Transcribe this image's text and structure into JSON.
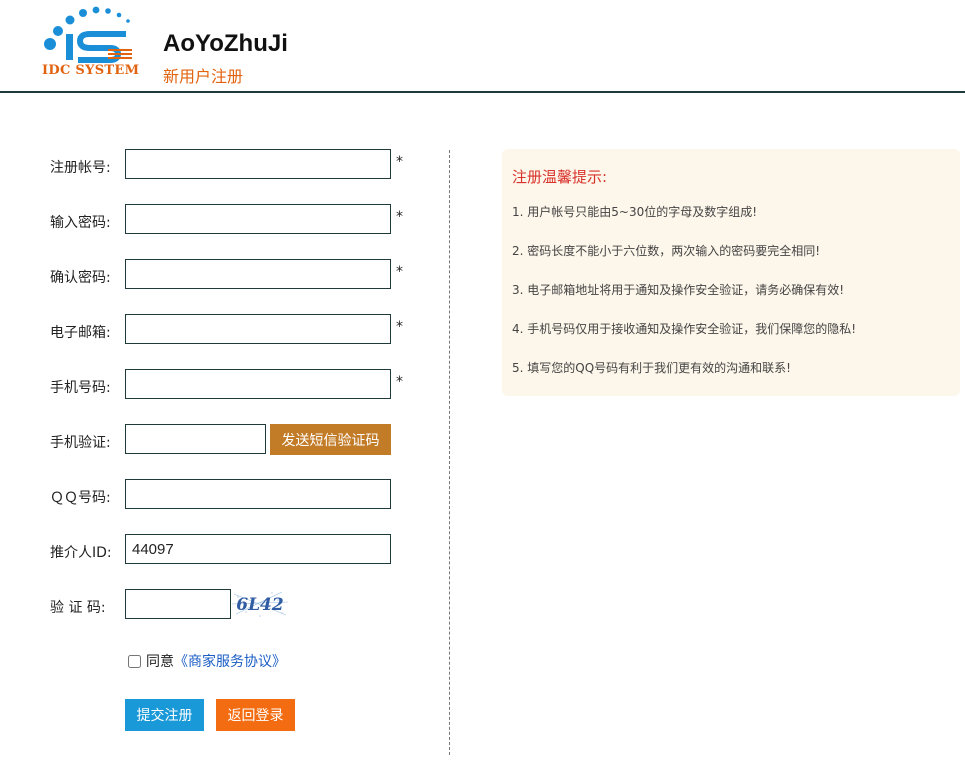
{
  "header": {
    "logo_text": "IDC SYSTEM",
    "site_title": "AoYoZhuJi",
    "subtitle": "新用户注册"
  },
  "form": {
    "fields": [
      {
        "label": "注册帐号:",
        "value": "",
        "required": "*"
      },
      {
        "label": "输入密码:",
        "value": "",
        "required": "*"
      },
      {
        "label": "确认密码:",
        "value": "",
        "required": "*"
      },
      {
        "label": "电子邮箱:",
        "value": "",
        "required": "*"
      },
      {
        "label": "手机号码:",
        "value": "",
        "required": "*"
      },
      {
        "label": "手机验证:",
        "value": ""
      },
      {
        "label": "ＱＱ号码:",
        "value": ""
      },
      {
        "label": "推介人ID:",
        "value": "44097"
      },
      {
        "label": "验 证 码:",
        "value": ""
      }
    ],
    "sms_button": "发送短信验证码",
    "captcha_text": "6L42",
    "agree_text": "同意",
    "agree_link": "《商家服务协议》",
    "submit_label": "提交注册",
    "back_label": "返回登录"
  },
  "tips": {
    "title": "注册温馨提示:",
    "items": [
      "1. 用户帐号只能由5~30位的字母及数字组成!",
      "2. 密码长度不能小于六位数，两次输入的密码要完全相同!",
      "3. 电子邮箱地址将用于通知及操作安全验证，请务必确保有效!",
      "4. 手机号码仅用于接收通知及操作安全验证，我们保障您的隐私!",
      "5. 填写您的QQ号码有利于我们更有效的沟通和联系!"
    ]
  },
  "colors": {
    "accent_orange": "#e2630f",
    "sms_button": "#c27b27",
    "submit_button": "#1a99d8",
    "back_button": "#f36c12",
    "tips_title": "#d9322b",
    "tips_bg": "#fdf6ea"
  }
}
